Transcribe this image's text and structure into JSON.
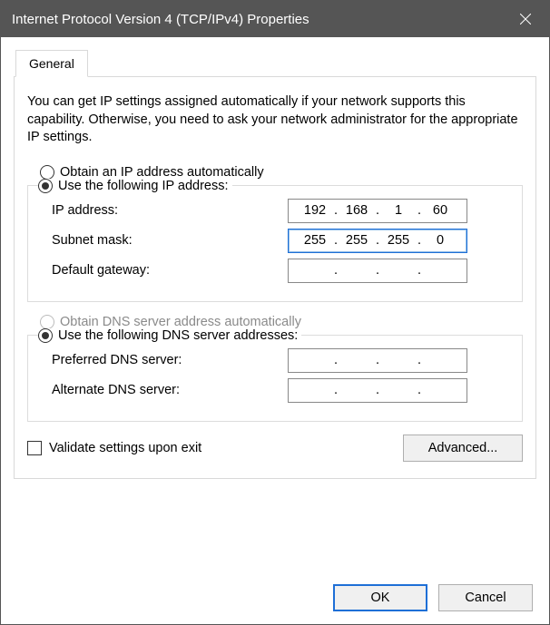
{
  "window": {
    "title": "Internet Protocol Version 4 (TCP/IPv4) Properties"
  },
  "tab": {
    "general": "General"
  },
  "description": "You can get IP settings assigned automatically if your network supports this capability. Otherwise, you need to ask your network administrator for the appropriate IP settings.",
  "ip_group": {
    "auto_label": "Obtain an IP address automatically",
    "manual_label": "Use the following IP address:",
    "ip_label": "IP address:",
    "subnet_label": "Subnet mask:",
    "gateway_label": "Default gateway:",
    "ip_value": {
      "o1": "192",
      "o2": "168",
      "o3": "1",
      "o4": "60"
    },
    "subnet_value": {
      "o1": "255",
      "o2": "255",
      "o3": "255",
      "o4": "0"
    },
    "gateway_value": {
      "o1": "",
      "o2": "",
      "o3": "",
      "o4": ""
    }
  },
  "dns_group": {
    "auto_label": "Obtain DNS server address automatically",
    "manual_label": "Use the following DNS server addresses:",
    "preferred_label": "Preferred DNS server:",
    "alternate_label": "Alternate DNS server:",
    "preferred_value": {
      "o1": "",
      "o2": "",
      "o3": "",
      "o4": ""
    },
    "alternate_value": {
      "o1": "",
      "o2": "",
      "o3": "",
      "o4": ""
    }
  },
  "validate_label": "Validate settings upon exit",
  "buttons": {
    "advanced": "Advanced...",
    "ok": "OK",
    "cancel": "Cancel"
  }
}
